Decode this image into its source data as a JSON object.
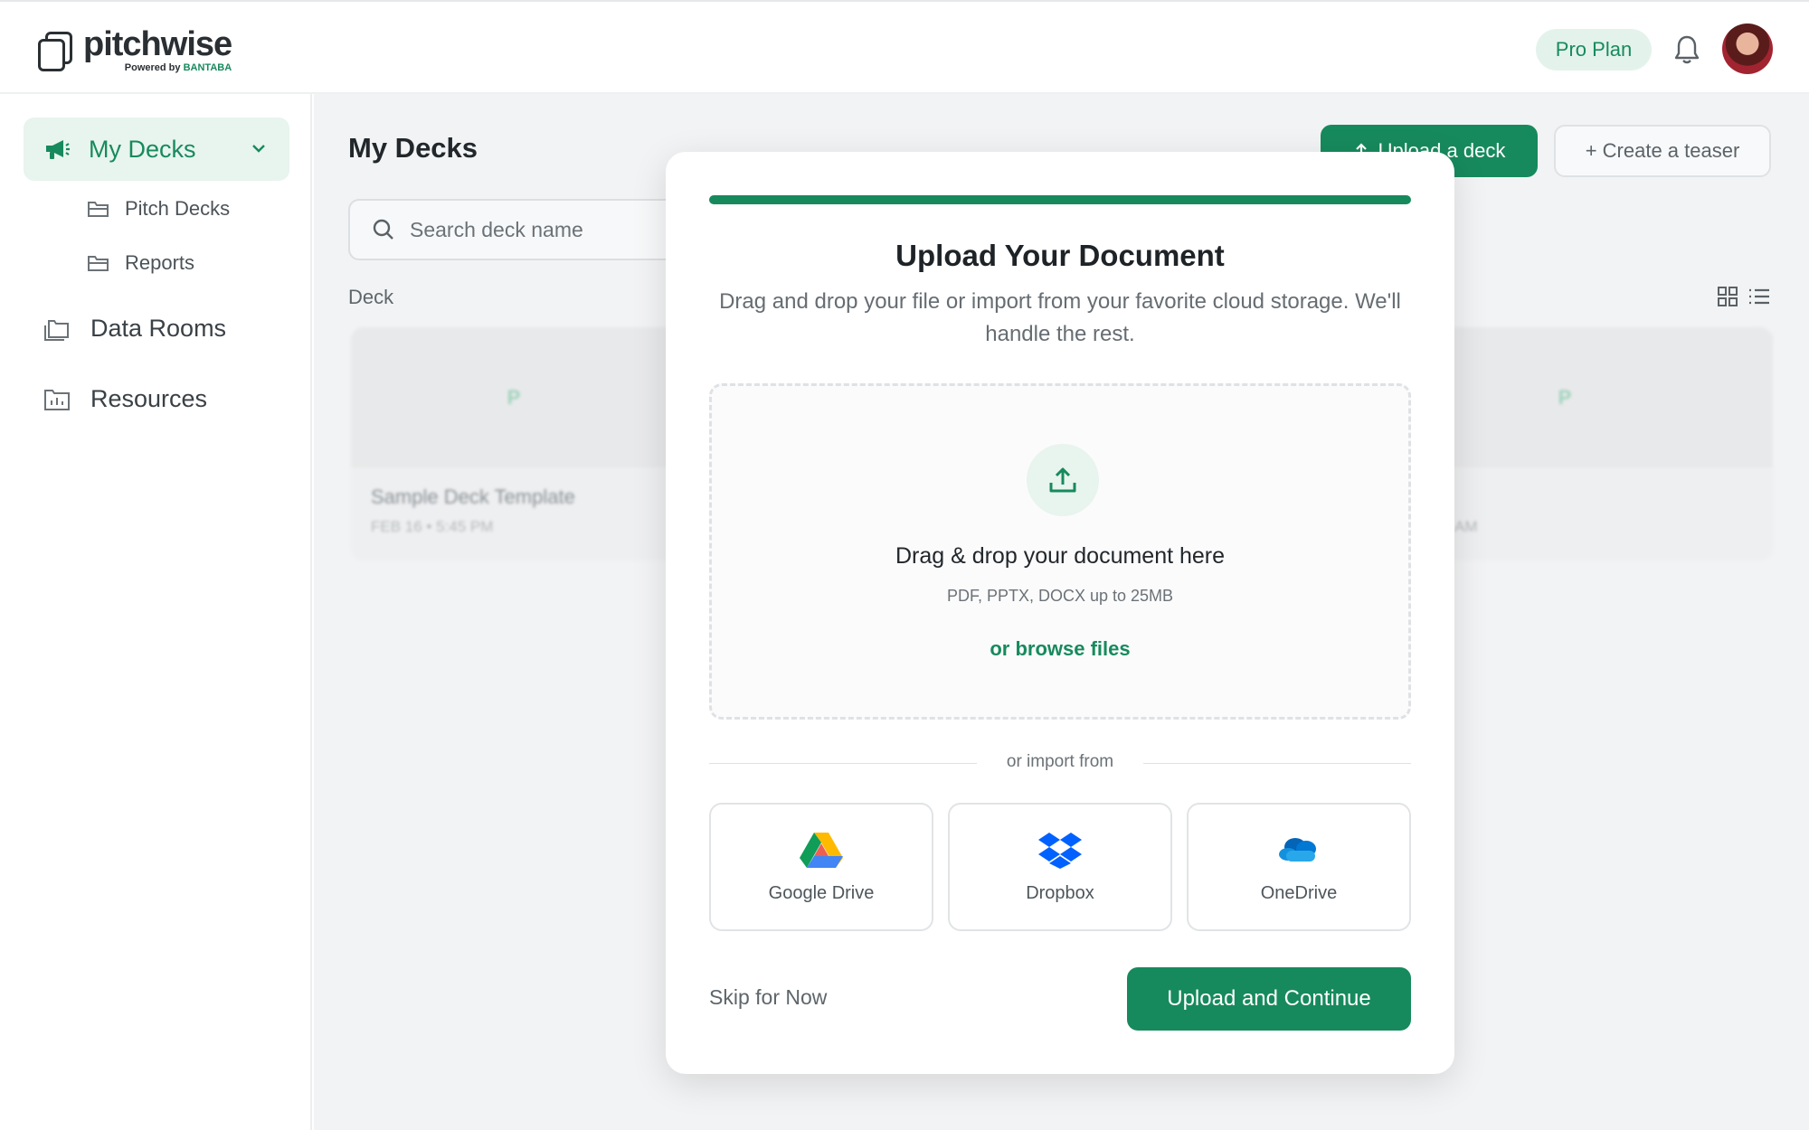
{
  "brand": {
    "name": "pitchwise",
    "powered_prefix": "Powered by",
    "powered_brand": "BANTABA"
  },
  "header": {
    "plan_label": "Pro Plan"
  },
  "sidebar": {
    "active": {
      "label": "My Decks"
    },
    "sub_items": [
      {
        "label": "Pitch Decks"
      },
      {
        "label": "Reports"
      }
    ],
    "items": [
      {
        "label": "Data Rooms"
      },
      {
        "label": "Resources"
      }
    ]
  },
  "main": {
    "title": "My Decks",
    "upload_button": "Upload a deck",
    "teaser_button": "+ Create a teaser",
    "search_placeholder": "Search deck name",
    "section_label": "Deck",
    "cards": [
      {
        "initial": "P",
        "title": "Sample Deck Template",
        "date": "FEB 16 • 5:45 PM"
      },
      {
        "initial": "P",
        "title": "",
        "date": "AM"
      }
    ]
  },
  "modal": {
    "progress_percent": 100,
    "title": "Upload Your Document",
    "description": "Drag and drop your file or import from your favorite cloud storage. We'll handle the rest.",
    "dropzone": {
      "title": "Drag & drop your document here",
      "formats": "PDF, PPTX, DOCX up to 25MB",
      "browse": "or browse files"
    },
    "import_label": "or import from",
    "sources": [
      {
        "name": "Google Drive",
        "icon": "google-drive-icon"
      },
      {
        "name": "Dropbox",
        "icon": "dropbox-icon"
      },
      {
        "name": "OneDrive",
        "icon": "onedrive-icon"
      }
    ],
    "skip_label": "Skip for Now",
    "continue_label": "Upload and Continue"
  },
  "colors": {
    "brand_green": "#178a5d",
    "light_green": "#e8f4ee"
  }
}
